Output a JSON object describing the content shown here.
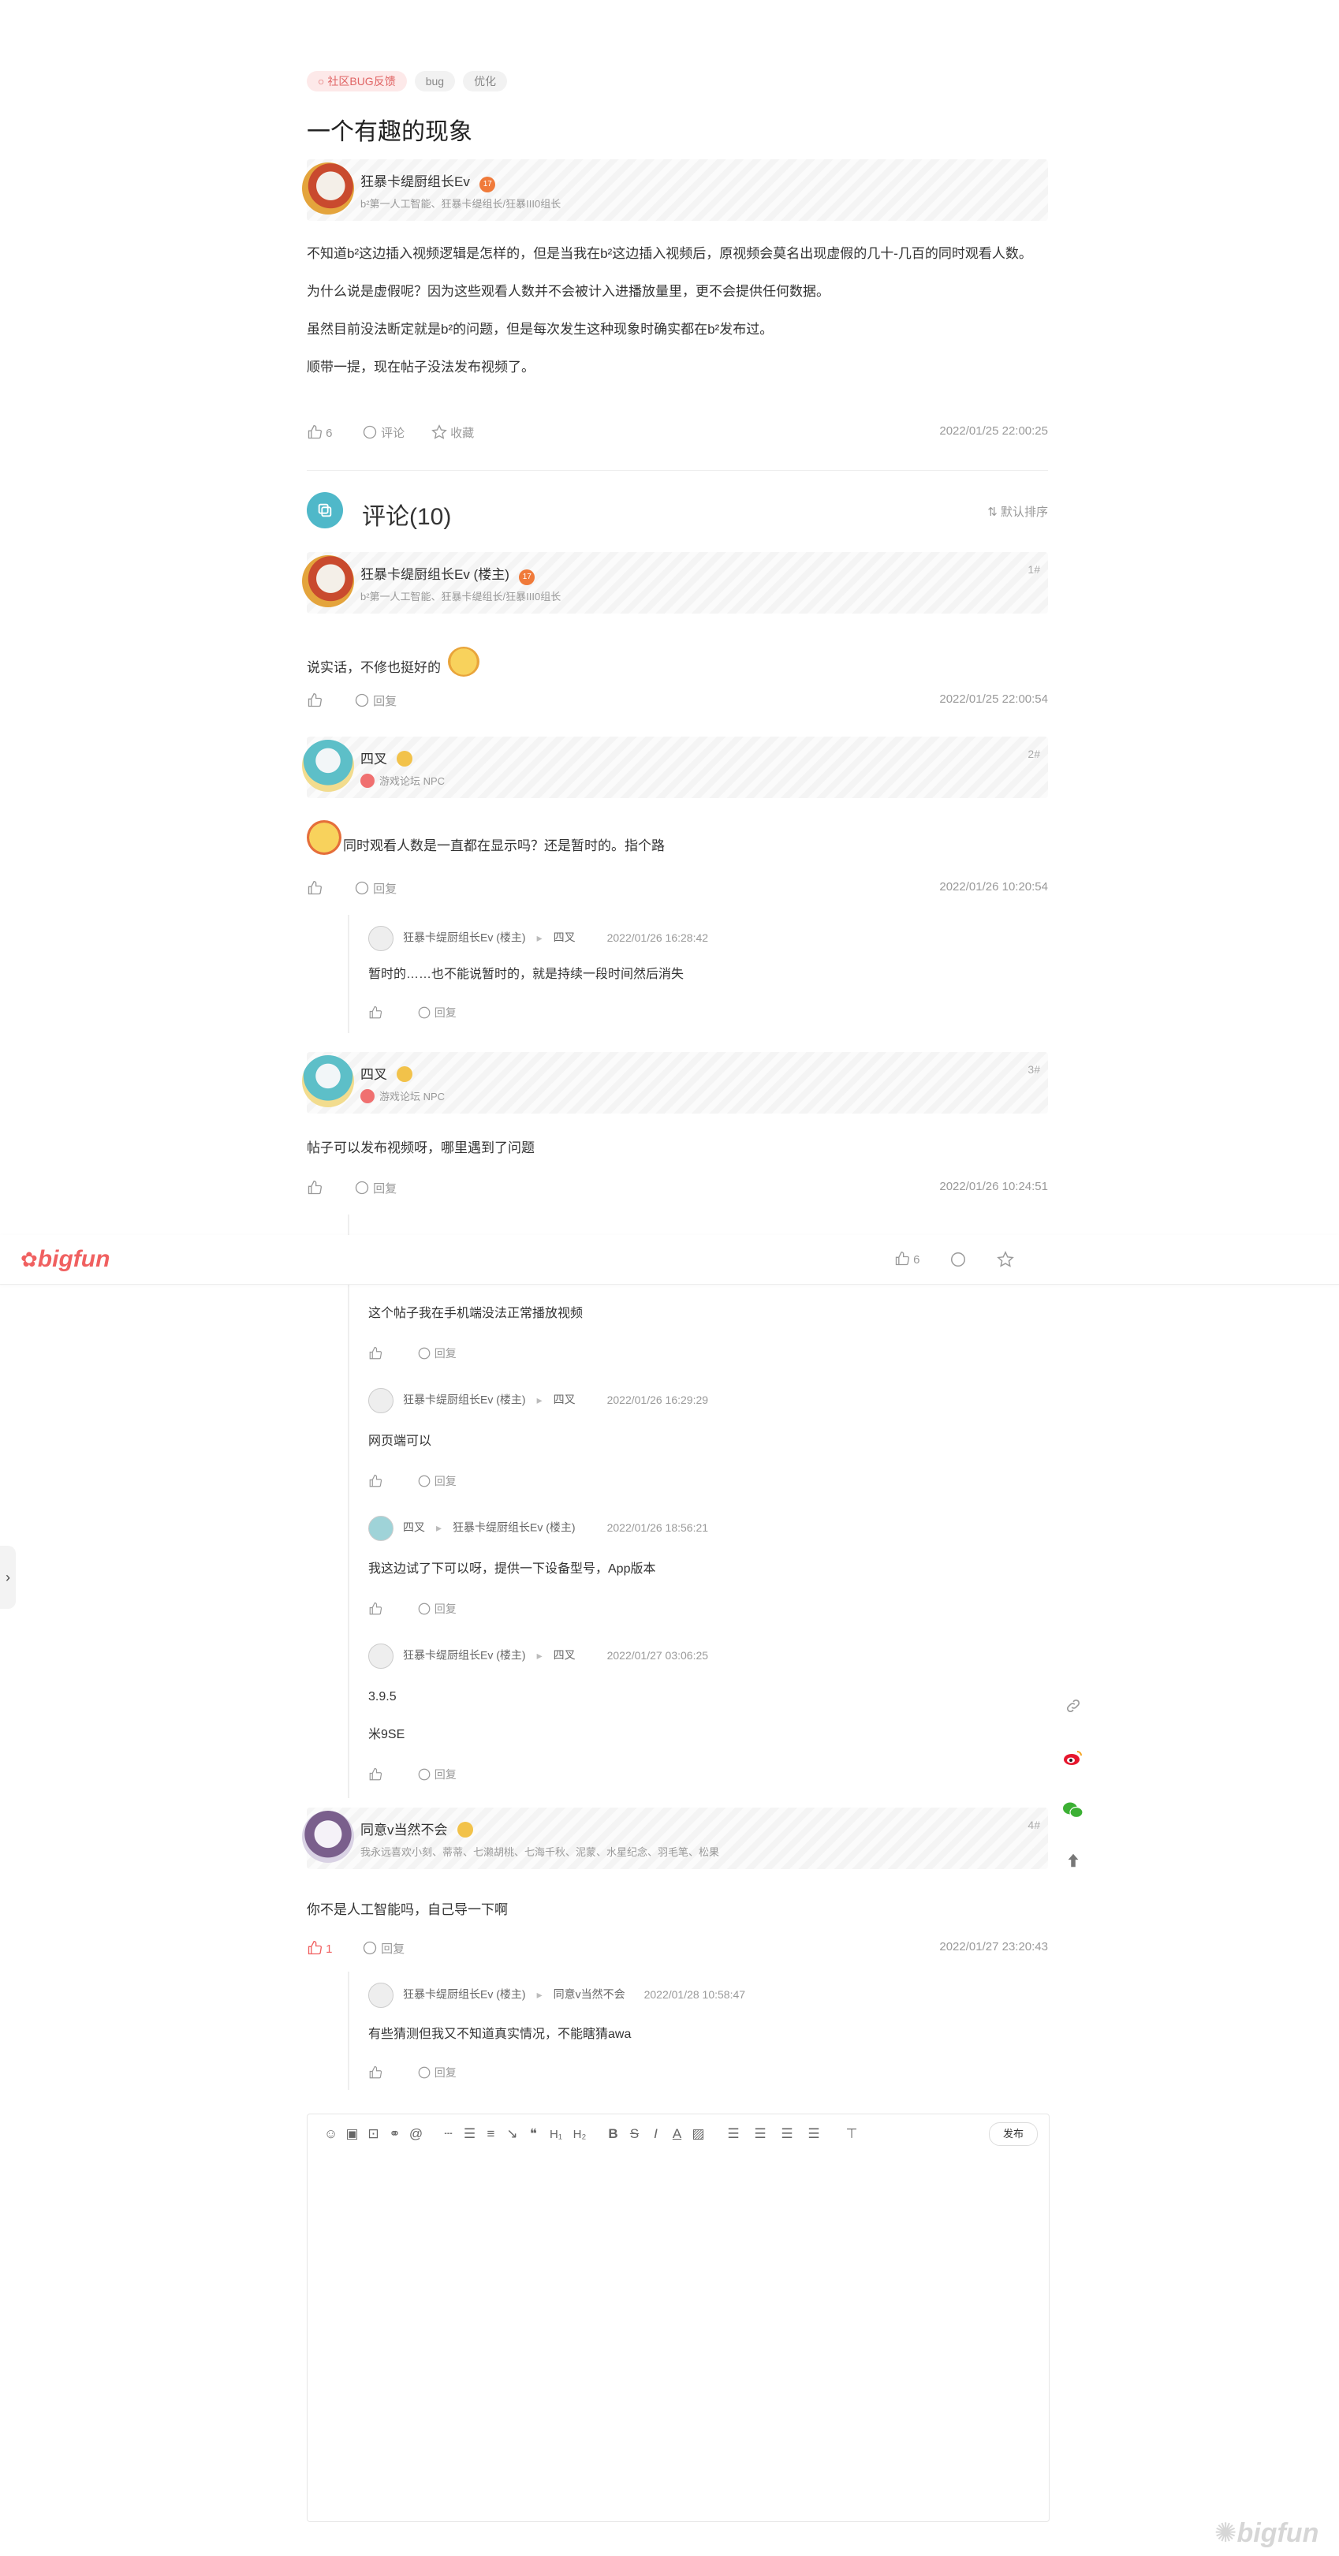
{
  "post": {
    "tags": [
      "社区BUG反馈",
      "bug",
      "优化"
    ],
    "title": "一个有趣的现象",
    "author": {
      "name": "狂暴卡缇厨组长Ev",
      "level": "17",
      "title": "b²第一人工智能、狂暴卡缇组长/狂暴III0组长"
    },
    "paragraphs": [
      "不知道b²这边插入视频逻辑是怎样的，但是当我在b²这边插入视频后，原视频会莫名出现虚假的几十-几百的同时观看人数。",
      "为什么说是虚假呢？因为这些观看人数并不会被计入进播放量里，更不会提供任何数据。",
      "虽然目前没法断定就是b²的问题，但是每次发生这种现象时确实都在b²发布过。",
      "顺带一提，现在帖子没法发布视频了。"
    ],
    "like_count": "6",
    "comment_label": "评论",
    "collect_label": "收藏",
    "time": "2022/01/25 22:00:25"
  },
  "comments_header": {
    "title": "评论(10)",
    "sort_label": "默认排序"
  },
  "comments": [
    {
      "floor": "1#",
      "name": "狂暴卡缇厨组长Ev (楼主)",
      "level": "17",
      "info": "b²第一人工智能、狂暴卡缇组长/狂暴III0组长",
      "text": "说实话，不修也挺好的",
      "time": "2022/01/25 22:00:54",
      "reply_label": "回复"
    },
    {
      "floor": "2#",
      "name": "四叉",
      "info": "游戏论坛 NPC",
      "text": "同时观看人数是一直都在显示吗？还是暂时的。指个路",
      "time": "2022/01/26 10:20:54",
      "reply_label": "回复",
      "replies": [
        {
          "from": "狂暴卡缇厨组长Ev (楼主)",
          "to": "四叉",
          "time": "2022/01/26 16:28:42",
          "text": "暂时的……也不能说暂时的，就是持续一段时间然后消失",
          "reply_label": "回复"
        }
      ]
    },
    {
      "floor": "3#",
      "name": "四叉",
      "info": "游戏论坛 NPC",
      "text": "帖子可以发布视频呀，哪里遇到了问题",
      "time": "2022/01/26 10:24:51",
      "reply_label": "回复",
      "replies": [
        {
          "text": "这个帖子我在手机端没法正常播放视频",
          "reply_label": "回复"
        },
        {
          "from": "狂暴卡缇厨组长Ev (楼主)",
          "to": "四叉",
          "time": "2022/01/26 16:29:29",
          "text": "网页端可以",
          "reply_label": "回复"
        },
        {
          "from": "四叉",
          "to": "狂暴卡缇厨组长Ev (楼主)",
          "time": "2022/01/26 18:56:21",
          "text": "我这边试了下可以呀，提供一下设备型号，App版本",
          "reply_label": "回复"
        },
        {
          "from": "狂暴卡缇厨组长Ev (楼主)",
          "to": "四叉",
          "time": "2022/01/27 03:06:25",
          "text": "3.9.5",
          "text2": "米9SE",
          "reply_label": "回复"
        }
      ]
    },
    {
      "floor": "4#",
      "name": "同意v当然不会",
      "info": "我永远喜欢小刻、蒂蒂、七濑胡桃、七海千秋、泥蒙、水星纪念、羽毛笔、松果",
      "text": "你不是人工智能吗，自己导一下啊",
      "like_count": "1",
      "time": "2022/01/27 23:20:43",
      "reply_label": "回复",
      "replies": [
        {
          "from": "狂暴卡缇厨组长Ev (楼主)",
          "to": "同意v当然不会",
          "time": "2022/01/28 10:58:47",
          "text": "有些猜测但我又不知道真实情况，不能瞎猜awa",
          "reply_label": "回复"
        }
      ]
    }
  ],
  "sticky": {
    "logo": "bigfun",
    "like_count": "6"
  },
  "editor": {
    "publish_label": "发布"
  },
  "watermark": "bigfun",
  "colors": {
    "accent": "#4fb8c9",
    "brand": "#f06060",
    "text": "#333333",
    "muted": "#999999"
  }
}
